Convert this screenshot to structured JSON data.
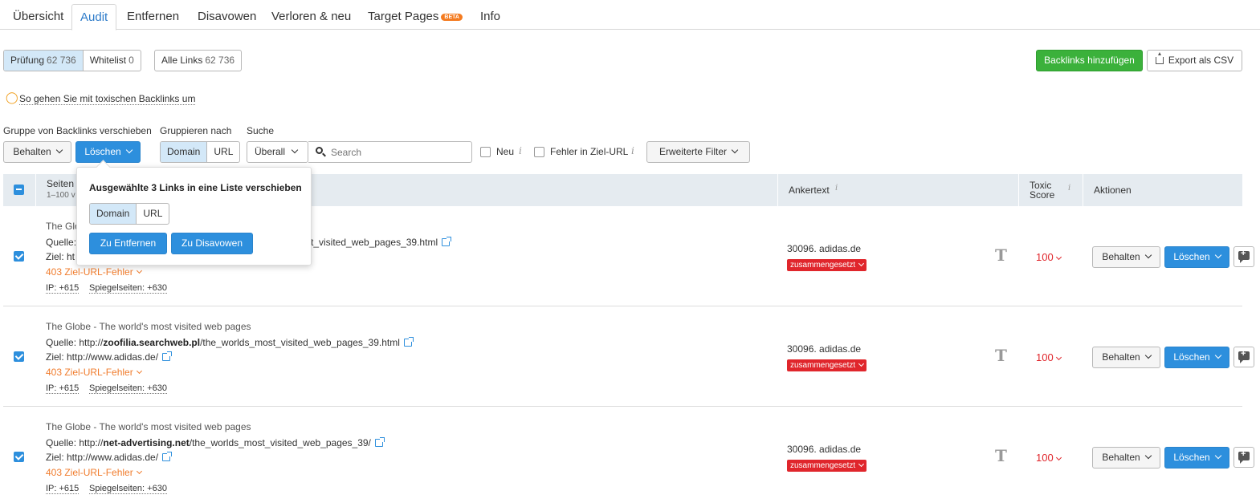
{
  "tabs": {
    "overview": "Übersicht",
    "audit": "Audit",
    "remove": "Entfernen",
    "disavow": "Disavowen",
    "lost_new": "Verloren & neu",
    "target_pages": "Target Pages",
    "target_badge": "BETA",
    "info": "Info"
  },
  "filters": {
    "pruefung_label": "Prüfung",
    "pruefung_count": "62 736",
    "whitelist_label": "Whitelist",
    "whitelist_count": "0",
    "all_links_label": "Alle Links",
    "all_links_count": "62 736"
  },
  "actions": {
    "add_backlinks": "Backlinks hinzufügen",
    "export_csv": "Export als CSV"
  },
  "help_link": "So gehen Sie mit toxischen Backlinks um",
  "toolbar": {
    "move_group_label": "Gruppe von Backlinks verschieben",
    "keep": "Behalten",
    "delete": "Löschen",
    "group_by_label": "Gruppieren nach",
    "group_domain": "Domain",
    "group_url": "URL",
    "search_label": "Suche",
    "search_scope": "Überall",
    "search_placeholder": "Search",
    "new_label": "Neu",
    "target_error_label": "Fehler in Ziel-URL",
    "advanced_filter": "Erweiterte Filter"
  },
  "popup": {
    "title": "Ausgewählte 3 Links in eine Liste verschieben",
    "domain": "Domain",
    "url": "URL",
    "to_remove": "Zu Entfernen",
    "to_disavow": "Zu Disavowen"
  },
  "table": {
    "col_pages": "Seiten",
    "col_pages_sub": "1–100 v",
    "col_anchor": "Ankertext",
    "col_toxic_1": "Toxic",
    "col_toxic_2": "Score",
    "col_actions": "Aktionen"
  },
  "rows": [
    {
      "title": "The Glo",
      "source_prefix": "Quelle: ",
      "source_proto": "",
      "source_domain": "",
      "source_path": "st_visited_web_pages_39.html",
      "target_prefix": "Ziel: ht",
      "error": "403 Ziel-URL-Fehler",
      "ip": "IP: +615",
      "mirror": "Spiegelseiten: +630",
      "anchor": "30096. adidas.de",
      "anchor_tag": "zusammengesetzt",
      "score": "100",
      "keep": "Behalten",
      "delete": "Löschen"
    },
    {
      "title": "The Globe - The world's most visited web pages",
      "source_prefix": "Quelle: ",
      "source_proto": "http://",
      "source_domain": "zoofilia.searchweb.pl",
      "source_path": "/the_worlds_most_visited_web_pages_39.html",
      "target_prefix": "Ziel: http://www.adidas.de/",
      "error": "403 Ziel-URL-Fehler",
      "ip": "IP: +615",
      "mirror": "Spiegelseiten: +630",
      "anchor": "30096. adidas.de",
      "anchor_tag": "zusammengesetzt",
      "score": "100",
      "keep": "Behalten",
      "delete": "Löschen"
    },
    {
      "title": "The Globe - The world's most visited web pages",
      "source_prefix": "Quelle: ",
      "source_proto": "http://",
      "source_domain": "net-advertising.net",
      "source_path": "/the_worlds_most_visited_web_pages_39/",
      "target_prefix": "Ziel: http://www.adidas.de/",
      "error": "403 Ziel-URL-Fehler",
      "ip": "IP: +615",
      "mirror": "Spiegelseiten: +630",
      "anchor": "30096. adidas.de",
      "anchor_tag": "zusammengesetzt",
      "score": "100",
      "keep": "Behalten",
      "delete": "Löschen"
    }
  ]
}
